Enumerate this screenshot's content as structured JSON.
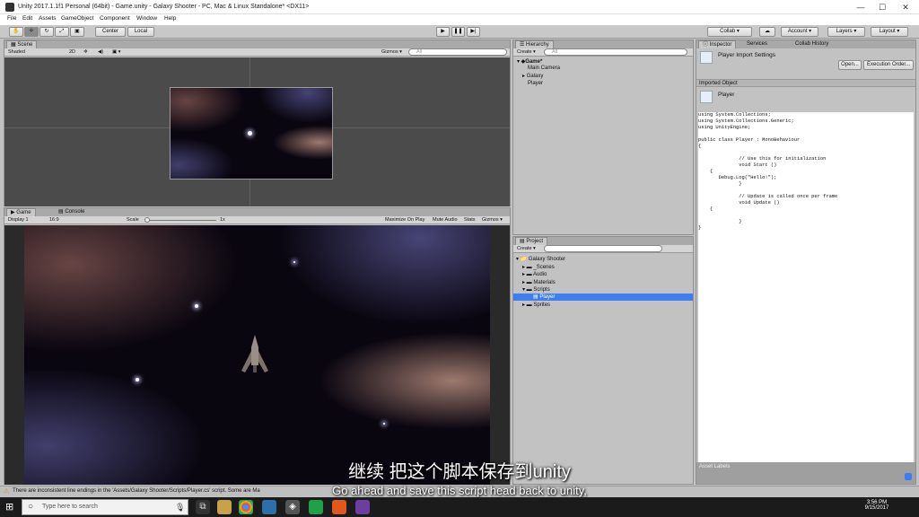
{
  "window": {
    "title": "Unity 2017.1.1f1 Personal (64bit) - Game.unity - Galaxy Shooter - PC, Mac & Linux Standalone* <DX11>",
    "minimize": "—",
    "maximize": "☐",
    "close": "✕"
  },
  "menu": [
    "File",
    "Edit",
    "Assets",
    "GameObject",
    "Component",
    "Window",
    "Help"
  ],
  "toolbar": {
    "center": "Center",
    "local": "Local",
    "collab": "Collab ▾",
    "account": "Account ▾",
    "layers": "Layers ▾",
    "layout": "Layout ▾"
  },
  "scene": {
    "tab": "Scene",
    "shading": "Shaded",
    "mode2d": "2D",
    "gizmos": "Gizmos ▾",
    "search": "All"
  },
  "game": {
    "tab": "Game",
    "console_tab": "Console",
    "display": "Display 1",
    "aspect": "16:9",
    "scale_label": "Scale",
    "scale_value": "1x",
    "maximize": "Maximize On Play",
    "mute": "Mute Audio",
    "stats": "Stats",
    "gizmos": "Gizmos ▾"
  },
  "hierarchy": {
    "tab": "Hierarchy",
    "create": "Create ▾",
    "search": "All",
    "scene_name": "Game*",
    "items": [
      "Main Camera",
      "Galaxy",
      "Player"
    ]
  },
  "project": {
    "tab": "Project",
    "create": "Create ▾",
    "root": "Galaxy Shooter",
    "folders": [
      "_Scenes",
      "Audio",
      "Materials",
      "Scripts",
      "Sprites"
    ],
    "selected": "Player"
  },
  "inspector": {
    "tab": "Inspector",
    "services_tab": "Services",
    "collab_tab": "Collab History",
    "title": "Player Import Settings",
    "open_btn": "Open...",
    "exec_btn": "Execution Order...",
    "imported_header": "Imported Object",
    "object_name": "Player",
    "code": "using System.Collections;\nusing System.Collections.Generic;\nusing UnityEngine;\n\npublic class Player : MonoBehaviour\n{\n\n              // Use this for initialization\n              void Start ()\n    {\n       Debug.Log(\"Hello!\");\n              }\n\n              // Update is called once per frame\n              void Update ()\n    {\n\n              }\n}",
    "asset_labels": "Asset Labels"
  },
  "status": {
    "warning": "There are inconsistent line endings in the 'Assets/Galaxy Shooter/Scripts/Player.cs' script. Some are Ma"
  },
  "subtitles": {
    "cn": "继续 把这个脚本保存到unity",
    "en": "Go ahead and save this script head back to unity,"
  },
  "taskbar": {
    "search": "Type here to search",
    "time": "3:56 PM",
    "date": "9/15/2017"
  },
  "colors": {
    "selection": "#3d7ff3",
    "taskbar": "#1b1b1b"
  }
}
